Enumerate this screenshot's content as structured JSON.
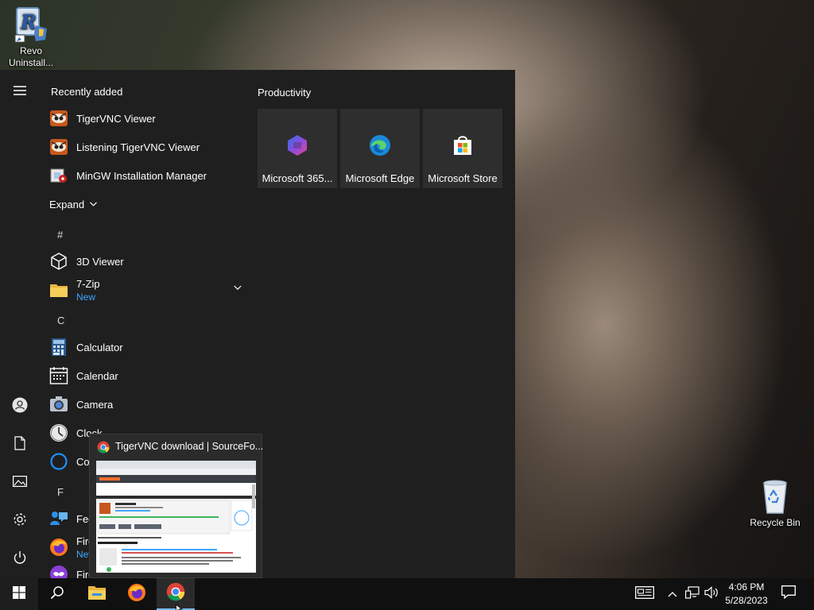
{
  "desktop": {
    "icons": [
      {
        "label": "Revo Uninstall..."
      },
      {
        "label": "Recycle Bin"
      }
    ]
  },
  "start_menu": {
    "recently_added_heading": "Recently added",
    "recent": [
      {
        "label": "TigerVNC Viewer",
        "icon": "tigervnc-icon"
      },
      {
        "label": "Listening TigerVNC Viewer",
        "icon": "tigervnc-icon"
      },
      {
        "label": "MinGW Installation Manager",
        "icon": "mingw-icon"
      }
    ],
    "expand_label": "Expand",
    "letters": [
      "#",
      "C",
      "F"
    ],
    "apps": [
      {
        "label": "3D Viewer",
        "icon": "cube-icon"
      },
      {
        "label": "7-Zip",
        "sub": "New",
        "icon": "folder-icon"
      },
      {
        "label": "Calculator",
        "icon": "calculator-icon"
      },
      {
        "label": "Calendar",
        "icon": "calendar-icon"
      },
      {
        "label": "Camera",
        "icon": "camera-icon"
      },
      {
        "label": "Clock",
        "icon": "clock-icon"
      },
      {
        "label": "Cor",
        "icon": "cortana-icon"
      },
      {
        "label": "Feed",
        "icon": "feedback-icon"
      },
      {
        "label": "Fire",
        "sub": "New",
        "icon": "firefox-icon"
      },
      {
        "label": "Fire",
        "icon": "firefox-private-icon"
      }
    ],
    "group_title": "Productivity",
    "tiles": [
      {
        "label": "Microsoft 365...",
        "icon": "m365-icon"
      },
      {
        "label": "Microsoft Edge",
        "icon": "edge-icon"
      },
      {
        "label": "Microsoft Store",
        "icon": "store-icon"
      }
    ],
    "rail": [
      "menu-icon",
      "user-icon",
      "documents-icon",
      "pictures-icon",
      "settings-icon",
      "power-icon"
    ]
  },
  "thumbnail": {
    "title": "TigerVNC download | SourceFo..."
  },
  "taskbar": {
    "time": "4:06 PM",
    "date": "5/28/2023"
  },
  "colors": {
    "menu_bg": "#1f1f1f",
    "tile_bg": "#2e2e2e",
    "taskbar_bg": "#101010",
    "accent_new": "#3ea6ff"
  }
}
